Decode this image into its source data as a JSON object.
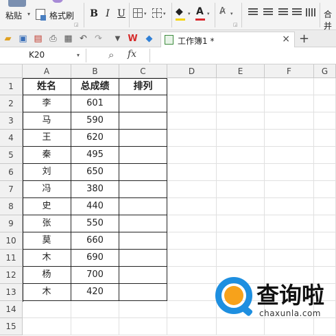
{
  "ribbon": {
    "paste_label": "粘贴",
    "format_painter_label": "格式刷",
    "bold": "B",
    "italic": "I",
    "underline": "U",
    "font_color_glyph": "A",
    "merge_label": "合并",
    "font_color": "#d9262c",
    "fill_color": "#f5d300"
  },
  "toolbar": {
    "tab_title": "工作簿1 *",
    "close_glyph": "×",
    "add_glyph": "+"
  },
  "formula_bar": {
    "name_box": "K20",
    "fx": "fx",
    "formula": ""
  },
  "sheet": {
    "columns": [
      "A",
      "B",
      "C",
      "D",
      "E",
      "F",
      "G"
    ],
    "rows": [
      "1",
      "2",
      "3",
      "4",
      "5",
      "6",
      "7",
      "8",
      "9",
      "10",
      "11",
      "12",
      "13",
      "14",
      "15"
    ],
    "headers": [
      "姓名",
      "总成绩",
      "排列"
    ],
    "data": [
      [
        "李",
        "601",
        ""
      ],
      [
        "马",
        "590",
        ""
      ],
      [
        "王",
        "620",
        ""
      ],
      [
        "秦",
        "495",
        ""
      ],
      [
        "刘",
        "650",
        ""
      ],
      [
        "冯",
        "380",
        ""
      ],
      [
        "史",
        "440",
        ""
      ],
      [
        "张",
        "550",
        ""
      ],
      [
        "莫",
        "660",
        ""
      ],
      [
        "木",
        "690",
        ""
      ],
      [
        "杨",
        "700",
        ""
      ],
      [
        "木",
        "420",
        ""
      ]
    ]
  },
  "watermark": {
    "title": "查询啦",
    "subtitle": "chaxunla.com",
    "ring_color": "#1e8fe0",
    "dot_color": "#f7a21b"
  }
}
